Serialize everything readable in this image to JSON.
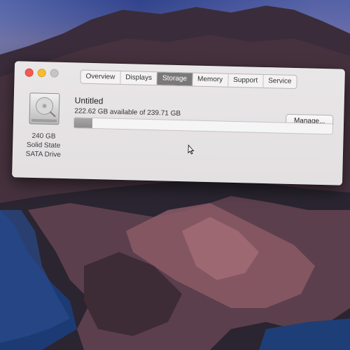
{
  "window": {
    "tabs": [
      {
        "label": "Overview",
        "active": false
      },
      {
        "label": "Displays",
        "active": false
      },
      {
        "label": "Storage",
        "active": true
      },
      {
        "label": "Memory",
        "active": false
      },
      {
        "label": "Support",
        "active": false
      },
      {
        "label": "Service",
        "active": false
      }
    ]
  },
  "drive": {
    "icon": "hard-drive-icon",
    "caption_line1": "240 GB",
    "caption_line2": "Solid State",
    "caption_line3": "SATA Drive"
  },
  "volume": {
    "name": "Untitled",
    "availability": "222.62 GB available of 239.71 GB",
    "used_fraction": 0.071,
    "manage_label": "Manage..."
  },
  "colors": {
    "close": "#f25b53",
    "minimize": "#f5bd33",
    "maximize": "#c7c4c6",
    "active_tab": "#7a7879"
  }
}
